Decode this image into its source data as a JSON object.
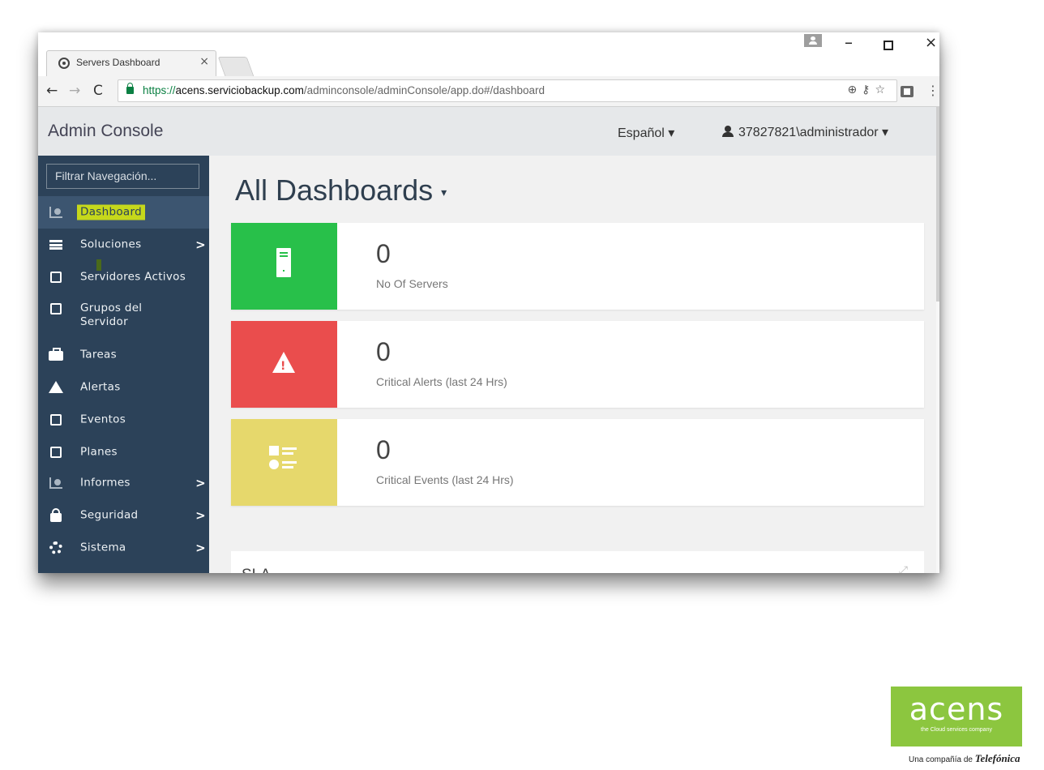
{
  "browser": {
    "tab_title": "Servers Dashboard",
    "tab_close": "×",
    "url_scheme": "https://",
    "url_host": "acens.serviciobackup.com",
    "url_path": "/adminconsole/adminConsole/app.do#/dashboard",
    "window_controls": {
      "minimize": "–",
      "close": "×"
    }
  },
  "header": {
    "title": "Admin Console",
    "language": "Español ▾",
    "user": "37827821\\administrador ▾"
  },
  "sidebar": {
    "filter_placeholder": "Filtrar Navegación...",
    "items": [
      {
        "label": "Dashboard",
        "icon": "chart-icon",
        "active": true,
        "highlighted": true,
        "has_children": false
      },
      {
        "label": "Soluciones",
        "icon": "layers-icon",
        "has_children": true
      },
      {
        "label": "Servidores Activos",
        "icon": "server-settings-icon",
        "has_children": false
      },
      {
        "label": "Grupos del\nServidor",
        "label_line1": "Grupos del",
        "label_line2": "Servidor",
        "icon": "server-group-icon",
        "has_children": false
      },
      {
        "label": "Tareas",
        "icon": "briefcase-icon",
        "has_children": false
      },
      {
        "label": "Alertas",
        "icon": "warning-icon",
        "has_children": false
      },
      {
        "label": "Eventos",
        "icon": "events-icon",
        "has_children": false
      },
      {
        "label": "Planes",
        "icon": "plan-doc-icon",
        "has_children": false
      },
      {
        "label": "Informes",
        "icon": "chart-icon",
        "has_children": true
      },
      {
        "label": "Seguridad",
        "icon": "lock-icon",
        "has_children": true
      },
      {
        "label": "Sistema",
        "icon": "gear-icon",
        "has_children": true
      }
    ],
    "chevron": ">"
  },
  "main": {
    "page_title": "All Dashboards",
    "title_caret": "▾",
    "cards": [
      {
        "value": "0",
        "label": "No Of Servers",
        "color": "#28c04a",
        "icon": "server-icon"
      },
      {
        "value": "0",
        "label": "Critical Alerts (last 24 Hrs)",
        "color": "#ea4d4d",
        "icon": "alert-triangle-icon"
      },
      {
        "value": "0",
        "label": "Critical Events (last 24 Hrs)",
        "color": "#e6d86c",
        "icon": "events-icon"
      }
    ],
    "sla_title": "SLA"
  },
  "branding": {
    "logo_word": "acens",
    "logo_tagline": "the Cloud services company",
    "subline_prefix": "Una compañía de ",
    "subline_brand": "Telefónica",
    "logo_color": "#8cc63f"
  },
  "colors": {
    "sidebar_bg": "#2c4259",
    "header_bg": "#e6e8ea",
    "highlight": "#c6d81b"
  }
}
